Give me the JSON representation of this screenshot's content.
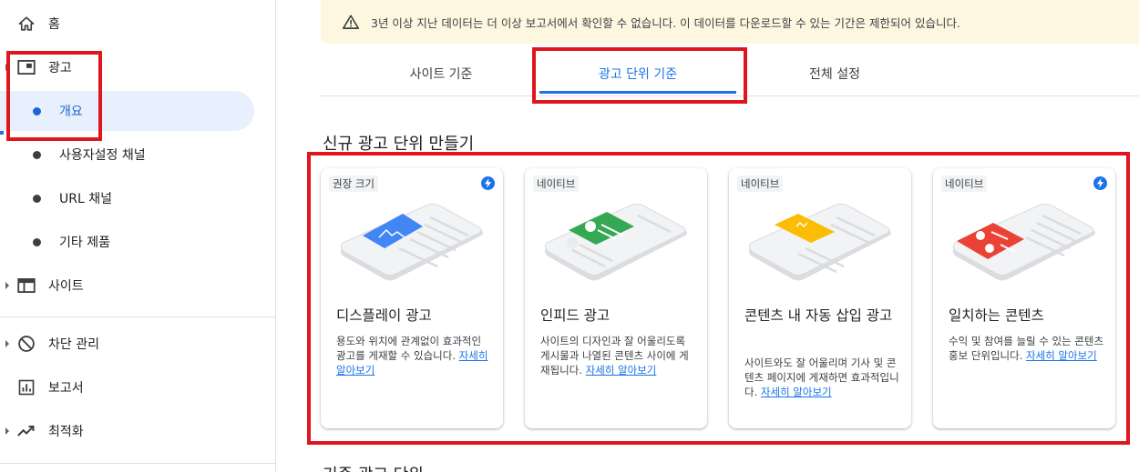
{
  "sidebar": {
    "home": "홈",
    "ads": "광고",
    "overview": "개요",
    "custom_channels": "사용자설정 채널",
    "url_channels": "URL 채널",
    "other_products": "기타 제품",
    "sites": "사이트",
    "blocking": "차단 관리",
    "reports": "보고서",
    "optimization": "최적화"
  },
  "notice": {
    "text": "3년 이상 지난 데이터는 더 이상 보고서에서 확인할 수 없습니다. 이 데이터를 다운로드할 수 있는 기간은 제한되어 있습니다."
  },
  "tabs": [
    {
      "label": "사이트 기준"
    },
    {
      "label": "광고 단위 기준"
    },
    {
      "label": "전체 설정"
    }
  ],
  "section_title": "신규 광고 단위 만들기",
  "section_title_2": "기존 광고 단위",
  "cards": [
    {
      "badge": "권장 크기",
      "title": "디스플레이 광고",
      "desc": "용도와 위치에 관계없이 효과적인 광고를 게재할 수 있습니다.",
      "link": "자세히 알아보기",
      "accent": "#4285f4"
    },
    {
      "badge": "네이티브",
      "title": "인피드 광고",
      "desc": "사이트의 디자인과 잘 어울리도록 게시물과 나열된 콘텐츠 사이에 게재됩니다.",
      "link": "자세히 알아보기",
      "accent": "#34a853"
    },
    {
      "badge": "네이티브",
      "title": "콘텐츠 내 자동 삽입 광고",
      "desc": "사이트와도 잘 어울리며 기사 및 콘텐츠 페이지에 게재하면 효과적입니다.",
      "link": "자세히 알아보기",
      "accent": "#fbbc04"
    },
    {
      "badge": "네이티브",
      "title": "일치하는 콘텐츠",
      "desc": "수익 및 참여를 늘릴 수 있는 콘텐츠 홍보 단위입니다.",
      "link": "자세히 알아보기",
      "accent": "#ea4335"
    }
  ],
  "colors": {
    "primary": "#1a73e8",
    "highlight": "#e0161f",
    "notice_bg": "#fef7e0"
  }
}
